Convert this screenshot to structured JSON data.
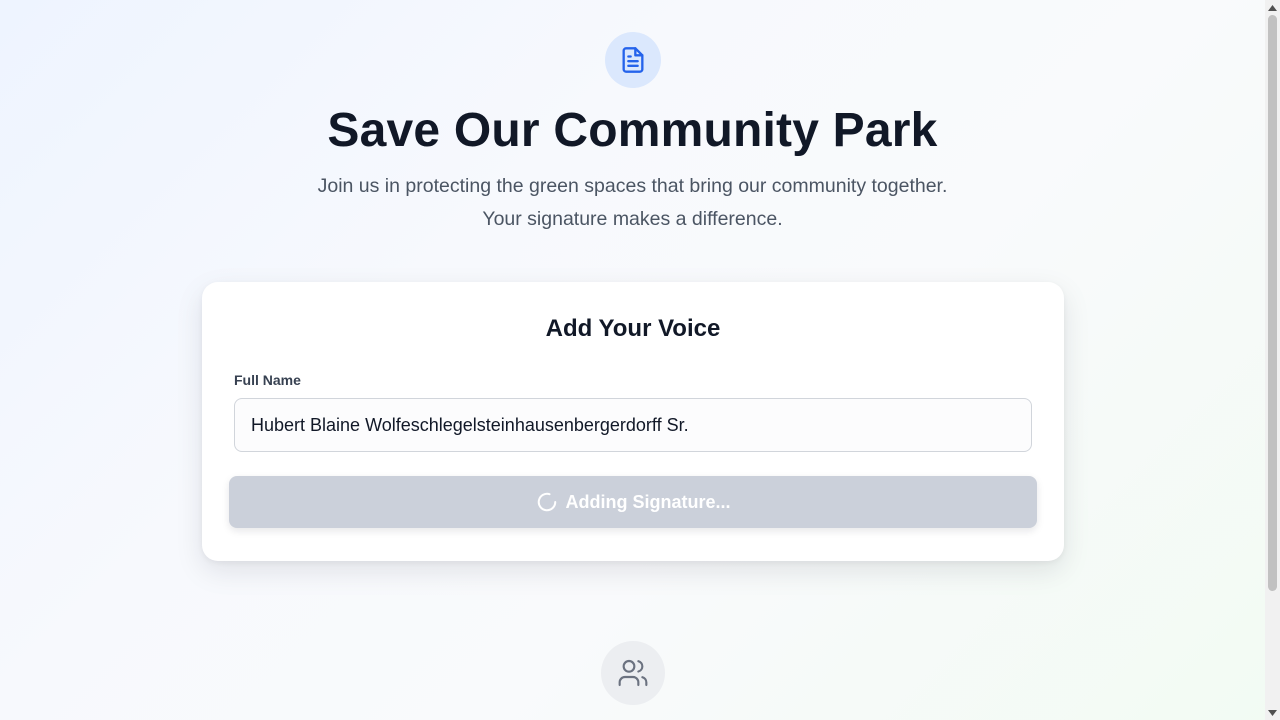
{
  "hero": {
    "icon": "document-icon",
    "title": "Save Our Community Park",
    "subtitle_line1": "Join us in protecting the green spaces that bring our community together.",
    "subtitle_line2": "Your signature makes a difference."
  },
  "form": {
    "heading": "Add Your Voice",
    "name_label": "Full Name",
    "name_value": "Hubert Blaine Wolfeschlegelsteinhausenbergerdorff Sr.",
    "submit_label": "Adding Signature...",
    "submit_state": "loading"
  },
  "footer": {
    "icon": "users-icon"
  },
  "colors": {
    "accent": "#2563eb",
    "accent_soft": "#dbe8fd",
    "button_disabled": "#cbd0da",
    "heading": "#111827",
    "muted_text": "#4b5563"
  }
}
